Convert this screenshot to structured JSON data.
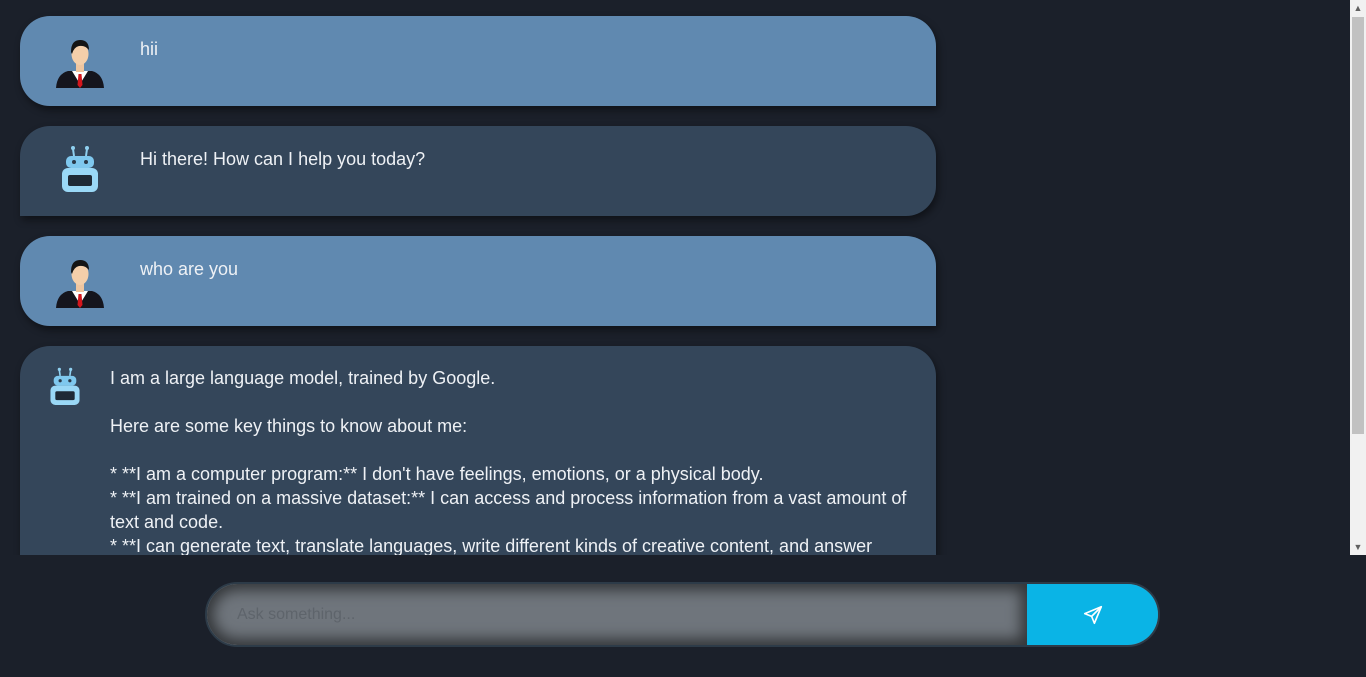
{
  "messages": [
    {
      "role": "user",
      "avatar": "user-avatar",
      "text": "hii"
    },
    {
      "role": "bot",
      "avatar": "robot-avatar",
      "text": "Hi there! How can I help you today?"
    },
    {
      "role": "user",
      "avatar": "user-avatar",
      "text": "who are you"
    },
    {
      "role": "bot",
      "avatar": "robot-avatar",
      "paragraphs": [
        "I am a large language model, trained by Google.",
        "Here are some key things to know about me:"
      ],
      "bullets": [
        "* **I am a computer program:** I don't have feelings, emotions, or a physical body.",
        "* **I am trained on a massive dataset:** I can access and process information from a vast amount of text and code.",
        "* **I can generate text, translate languages, write different kinds of creative content, and answer"
      ]
    }
  ],
  "input": {
    "placeholder": "Ask something...",
    "value": ""
  },
  "send_button": {
    "icon": "paper-plane-icon"
  },
  "colors": {
    "background": "#1b202a",
    "user_bubble": "#6089b0",
    "bot_bubble": "#34465a",
    "send_button": "#0ab4e6"
  }
}
